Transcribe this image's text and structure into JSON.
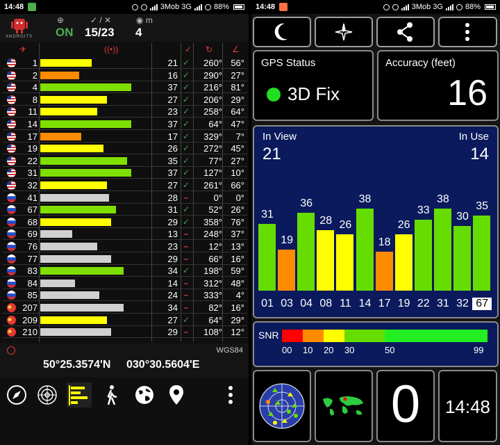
{
  "left": {
    "status": {
      "time": "14:48",
      "carrier": "3Mob 3G",
      "battery": "88%"
    },
    "header": {
      "logo_text": "ANDROITS",
      "gps_state": "ON",
      "sats": "15/23",
      "fix_count": "4",
      "m_label": "m"
    },
    "rows": [
      {
        "flag": "us",
        "prn": "1",
        "snr": "21",
        "use": true,
        "az": "260°",
        "el": "56°",
        "color": "#ffff00",
        "fill": 0.46
      },
      {
        "flag": "us",
        "prn": "2",
        "snr": "16",
        "use": true,
        "az": "290°",
        "el": "27°",
        "color": "#ff8c00",
        "fill": 0.35
      },
      {
        "flag": "us",
        "prn": "4",
        "snr": "37",
        "use": true,
        "az": "216°",
        "el": "81°",
        "color": "#7fe000",
        "fill": 0.82
      },
      {
        "flag": "us",
        "prn": "8",
        "snr": "27",
        "use": true,
        "az": "206°",
        "el": "29°",
        "color": "#ffff00",
        "fill": 0.6
      },
      {
        "flag": "us",
        "prn": "11",
        "snr": "23",
        "use": true,
        "az": "258°",
        "el": "64°",
        "color": "#ffff00",
        "fill": 0.51
      },
      {
        "flag": "us",
        "prn": "14",
        "snr": "37",
        "use": true,
        "az": "64°",
        "el": "47°",
        "color": "#7fe000",
        "fill": 0.82
      },
      {
        "flag": "us",
        "prn": "17",
        "snr": "17",
        "use": true,
        "az": "329°",
        "el": "7°",
        "color": "#ff8c00",
        "fill": 0.37
      },
      {
        "flag": "us",
        "prn": "19",
        "snr": "26",
        "use": true,
        "az": "272°",
        "el": "45°",
        "color": "#ffff00",
        "fill": 0.57
      },
      {
        "flag": "us",
        "prn": "22",
        "snr": "35",
        "use": true,
        "az": "77°",
        "el": "27°",
        "color": "#7fe000",
        "fill": 0.78
      },
      {
        "flag": "us",
        "prn": "31",
        "snr": "37",
        "use": true,
        "az": "127°",
        "el": "10°",
        "color": "#7fe000",
        "fill": 0.82
      },
      {
        "flag": "us",
        "prn": "32",
        "snr": "27",
        "use": true,
        "az": "261°",
        "el": "66°",
        "color": "#ffff00",
        "fill": 0.6
      },
      {
        "flag": "ru",
        "prn": "41",
        "snr": "28",
        "use": false,
        "az": "0°",
        "el": "0°",
        "color": "#d0d0d0",
        "fill": 0.62
      },
      {
        "flag": "ru",
        "prn": "67",
        "snr": "31",
        "use": true,
        "az": "52°",
        "el": "26°",
        "color": "#7fe000",
        "fill": 0.68
      },
      {
        "flag": "ru",
        "prn": "68",
        "snr": "29",
        "use": true,
        "az": "358°",
        "el": "76°",
        "color": "#ffff00",
        "fill": 0.64
      },
      {
        "flag": "ru",
        "prn": "69",
        "snr": "13",
        "use": false,
        "az": "248°",
        "el": "37°",
        "color": "#d0d0d0",
        "fill": 0.29
      },
      {
        "flag": "ru",
        "prn": "76",
        "snr": "23",
        "use": false,
        "az": "12°",
        "el": "13°",
        "color": "#d0d0d0",
        "fill": 0.51
      },
      {
        "flag": "ru",
        "prn": "77",
        "snr": "29",
        "use": false,
        "az": "66°",
        "el": "16°",
        "color": "#d0d0d0",
        "fill": 0.64
      },
      {
        "flag": "ru",
        "prn": "83",
        "snr": "34",
        "use": true,
        "az": "198°",
        "el": "59°",
        "color": "#7fe000",
        "fill": 0.75
      },
      {
        "flag": "ru",
        "prn": "84",
        "snr": "14",
        "use": false,
        "az": "312°",
        "el": "48°",
        "color": "#d0d0d0",
        "fill": 0.31
      },
      {
        "flag": "ru",
        "prn": "85",
        "snr": "24",
        "use": false,
        "az": "333°",
        "el": "4°",
        "color": "#d0d0d0",
        "fill": 0.53
      },
      {
        "flag": "cn",
        "prn": "207",
        "snr": "34",
        "use": false,
        "az": "82°",
        "el": "16°",
        "color": "#d0d0d0",
        "fill": 0.75
      },
      {
        "flag": "cn",
        "prn": "209",
        "snr": "27",
        "use": true,
        "az": "64°",
        "el": "29°",
        "color": "#ffff00",
        "fill": 0.6
      },
      {
        "flag": "cn",
        "prn": "210",
        "snr": "29",
        "use": false,
        "az": "108°",
        "el": "12°",
        "color": "#d0d0d0",
        "fill": 0.64
      }
    ],
    "datum": "WGS84",
    "lat": "50°25.3574'N",
    "lon": "030°30.5604'E"
  },
  "right": {
    "status": {
      "time": "14:48",
      "carrier": "3Mob 3G",
      "battery": "88%"
    },
    "gps_status_title": "GPS Status",
    "gps_fix": "3D Fix",
    "accuracy_title": "Accuracy (feet)",
    "accuracy_value": "16",
    "in_view_label": "In View",
    "in_view_value": "21",
    "in_use_label": "In Use",
    "in_use_value": "14",
    "sats": [
      {
        "prn": "01",
        "snr": "31",
        "color": "#66dd00"
      },
      {
        "prn": "03",
        "snr": "19",
        "color": "#ff8c00"
      },
      {
        "prn": "04",
        "snr": "36",
        "color": "#66dd00"
      },
      {
        "prn": "08",
        "snr": "28",
        "color": "#ffff00"
      },
      {
        "prn": "11",
        "snr": "26",
        "color": "#ffff00"
      },
      {
        "prn": "14",
        "snr": "38",
        "color": "#66dd00"
      },
      {
        "prn": "17",
        "snr": "18",
        "color": "#ff8c00"
      },
      {
        "prn": "19",
        "snr": "26",
        "color": "#ffff00"
      },
      {
        "prn": "22",
        "snr": "33",
        "color": "#66dd00"
      },
      {
        "prn": "31",
        "snr": "38",
        "color": "#66dd00"
      },
      {
        "prn": "32",
        "snr": "30",
        "color": "#66dd00"
      },
      {
        "prn": "67",
        "snr": "35",
        "color": "#66dd00"
      }
    ],
    "selected_prn": "67",
    "snr_label": "SNR",
    "snr_ticks": [
      "00",
      "10",
      "20",
      "30",
      "50",
      "99"
    ],
    "altitude_digit": "0",
    "clock": "14:48"
  }
}
